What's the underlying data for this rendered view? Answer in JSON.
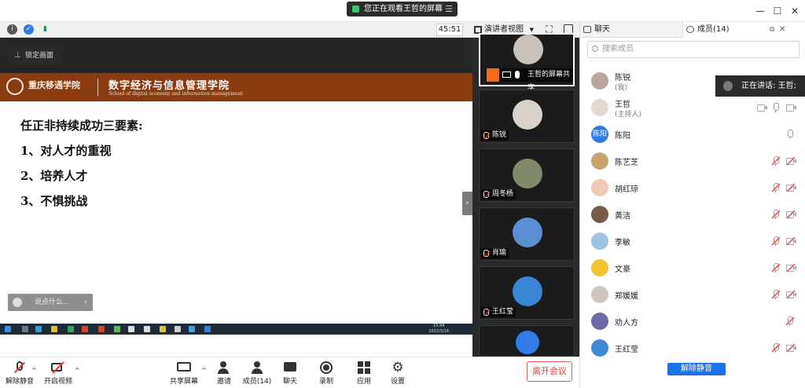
{
  "topbar": {
    "share_notice": "您正在观看王哲的屏幕",
    "menu_icon": "menu-icon",
    "window_controls": [
      "minimize-icon",
      "maximize-icon",
      "close-icon"
    ]
  },
  "videobar": {
    "timer": "45:51",
    "view_mode": "演讲者视图"
  },
  "share": {
    "lock_label": "锁定画面",
    "university": "重庆移通学院",
    "school_cn": "数字经济与信息管理学院",
    "school_en": "School of digital economy and information management",
    "slide_lines": [
      "任正非持续成功三要素:",
      "1、对人才的重视",
      "2、培养人才",
      "3、不惧挑战"
    ],
    "comment_placeholder": "说点什么...",
    "taskbar_time": "15:44",
    "taskbar_date": "2022/3/16"
  },
  "strip": {
    "tiles": [
      {
        "name": "王哲的屏幕共享",
        "avatar": "#c9c2b8"
      },
      {
        "name": "陈锐",
        "avatar": "#d8d1c8"
      },
      {
        "name": "周冬杨",
        "avatar": "#7f8a6a"
      },
      {
        "name": "肖瑜",
        "avatar": "#5b8fd1"
      },
      {
        "name": "王红莹",
        "avatar": "#3a86d6"
      }
    ]
  },
  "controls": {
    "unmute": "解除静音",
    "video": "开启视频",
    "share_screen": "共享屏幕",
    "invite": "邀请",
    "members": "成员(14)",
    "chat": "聊天",
    "record": "录制",
    "apps": "应用",
    "settings": "设置",
    "leave": "离开会议"
  },
  "panel": {
    "tab_chat": "聊天",
    "tab_members": "成员(14)",
    "search_placeholder": "搜索成员",
    "speaking": "正在讲话: 王哲;",
    "unmute_all": "解除静音",
    "members": [
      {
        "name": "陈锐",
        "role": "(我)",
        "avatar_color": "#b8a79a",
        "initial": "",
        "muted": false,
        "icons": "none"
      },
      {
        "name": "王哲",
        "role": "(主持人)",
        "avatar_color": "#e3d9d2",
        "initial": "",
        "muted": false,
        "icons": "share"
      },
      {
        "name": "陈阳",
        "role": "",
        "avatar_color": "#2f7be8",
        "initial": "陈阳",
        "muted": false,
        "icons": "mic"
      },
      {
        "name": "陈艺芝",
        "role": "",
        "avatar_color": "#c9a36f",
        "initial": "",
        "muted": true,
        "icons": "both"
      },
      {
        "name": "胡红琼",
        "role": "",
        "avatar_color": "#f0c9b4",
        "initial": "",
        "muted": true,
        "icons": "both"
      },
      {
        "name": "黄洁",
        "role": "",
        "avatar_color": "#7a5a48",
        "initial": "",
        "muted": true,
        "icons": "both"
      },
      {
        "name": "李敏",
        "role": "",
        "avatar_color": "#9cc4e4",
        "initial": "",
        "muted": true,
        "icons": "both"
      },
      {
        "name": "文豪",
        "role": "",
        "avatar_color": "#f2c230",
        "initial": "",
        "muted": true,
        "icons": "both"
      },
      {
        "name": "郑媛媛",
        "role": "",
        "avatar_color": "#cfc6be",
        "initial": "",
        "muted": true,
        "icons": "both"
      },
      {
        "name": "劝人方",
        "role": "",
        "avatar_color": "#6c6aa8",
        "initial": "",
        "muted": true,
        "icons": "mic"
      },
      {
        "name": "王红莹",
        "role": "",
        "avatar_color": "#3f8ad8",
        "initial": "",
        "muted": true,
        "icons": "both"
      }
    ]
  }
}
